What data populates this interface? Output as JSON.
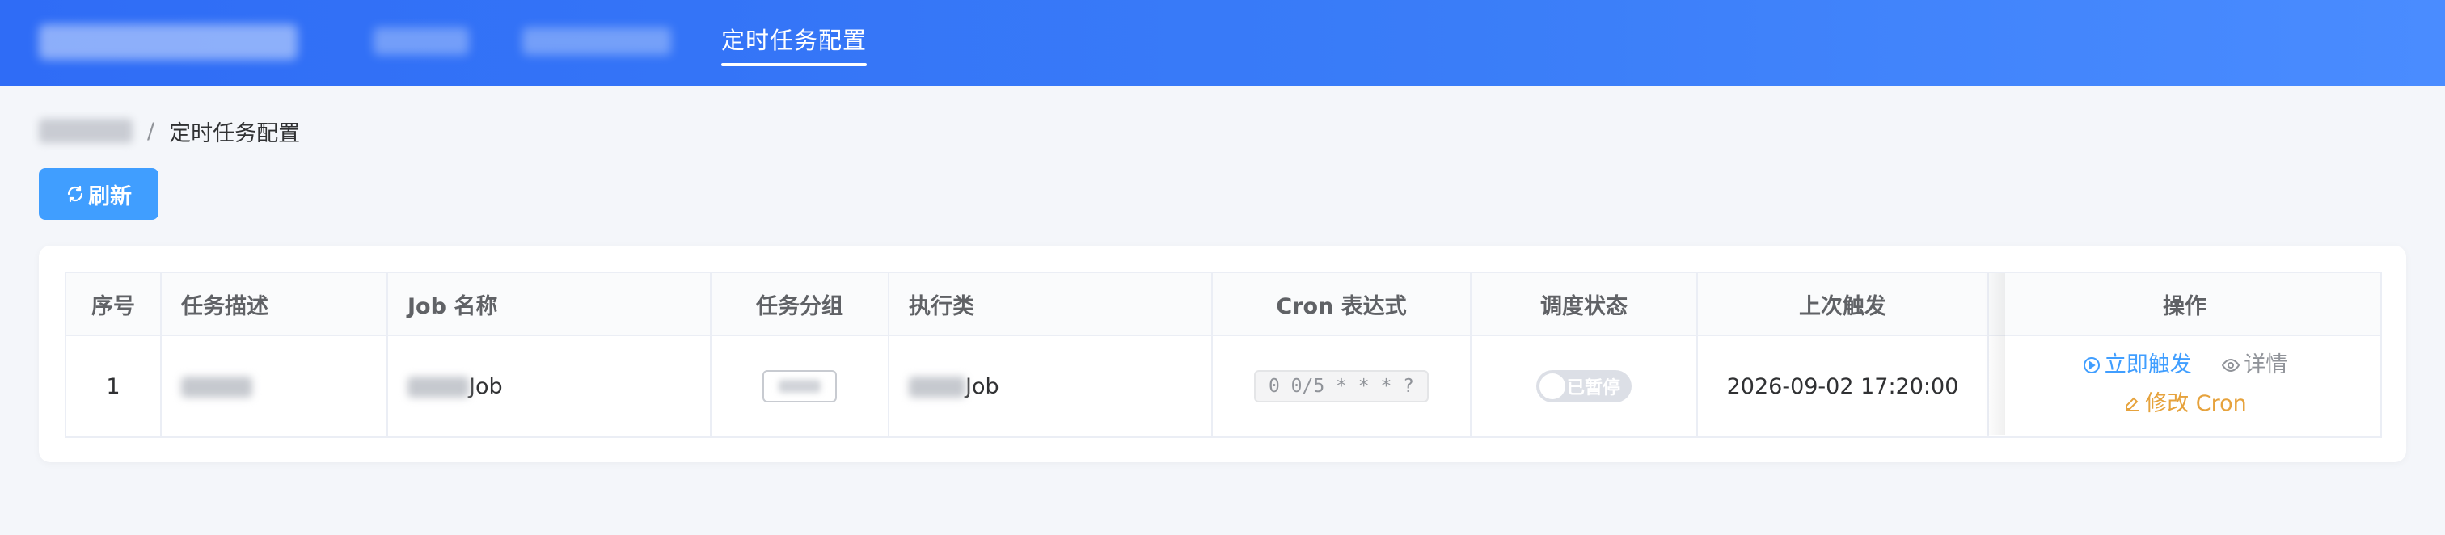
{
  "header": {
    "nav_active": "定时任务配置"
  },
  "breadcrumb": {
    "current": "定时任务配置",
    "separator": "/"
  },
  "toolbar": {
    "refresh_label": "刷新"
  },
  "table": {
    "columns": [
      "序号",
      "任务描述",
      "Job 名称",
      "任务分组",
      "执行类",
      "Cron 表达式",
      "调度状态",
      "上次触发",
      "操作"
    ],
    "rows": [
      {
        "index": "1",
        "job_name_suffix": "Job",
        "exec_class_suffix": "Job",
        "cron": "0 0/5 * * * ?",
        "status": "已暂停",
        "last_trigger": "2026-09-02 17:20:00"
      }
    ],
    "actions": {
      "trigger": "立即触发",
      "detail": "详情",
      "edit_cron": "修改 Cron"
    }
  },
  "colors": {
    "header_start": "#2f6cf6",
    "header_end": "#4a8cff",
    "primary": "#409eff",
    "warning": "#e6a23c",
    "muted": "#909399"
  },
  "icons": [
    "refresh-icon",
    "play-circle-icon",
    "eye-icon",
    "edit-icon"
  ]
}
